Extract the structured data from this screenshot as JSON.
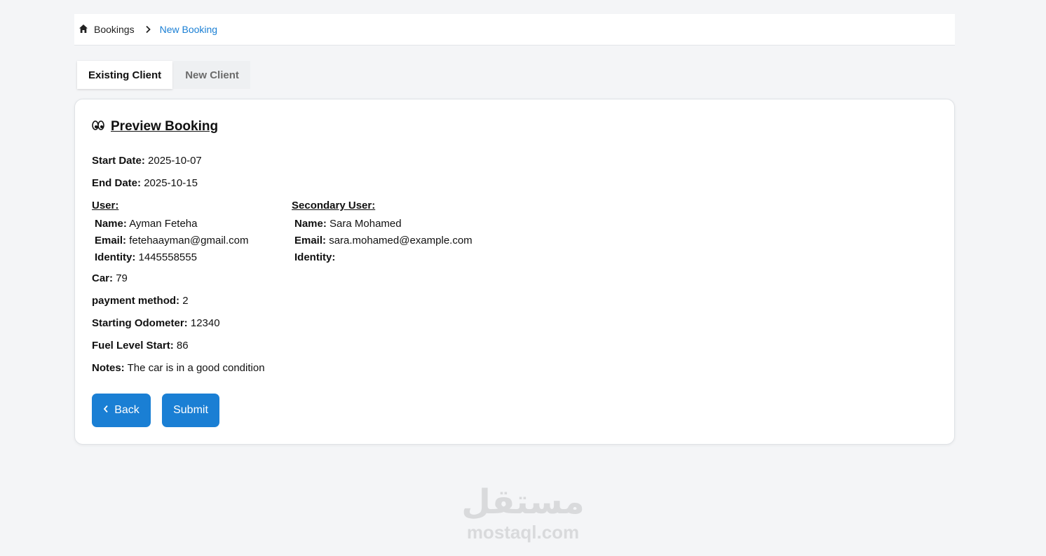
{
  "breadcrumb": {
    "home_icon": "home-icon",
    "home_label": "Bookings",
    "separator_icon": "chevron-right-icon",
    "current_label": "New Booking"
  },
  "tabs": [
    {
      "label": "Existing Client",
      "active": true
    },
    {
      "label": "New Client",
      "active": false
    }
  ],
  "preview": {
    "icon": "eyes-icon",
    "title": "Preview Booking",
    "start_date_label": "Start Date:",
    "start_date": "2025-10-07",
    "end_date_label": "End Date:",
    "end_date": "2025-10-15",
    "user": {
      "heading": "User:",
      "name_label": "Name:",
      "name": "Ayman Feteha",
      "email_label": "Email:",
      "email": "fetehaayman@gmail.com",
      "identity_label": "Identity:",
      "identity": "1445558555"
    },
    "secondary_user": {
      "heading": "Secondary User:",
      "name_label": "Name:",
      "name": "Sara Mohamed",
      "email_label": "Email:",
      "email": "sara.mohamed@example.com",
      "identity_label": "Identity:",
      "identity": ""
    },
    "car_label": "Car:",
    "car": "79",
    "payment_label": "payment method:",
    "payment": "2",
    "odometer_label": "Starting Odometer:",
    "odometer": "12340",
    "fuel_label": "Fuel Level Start:",
    "fuel": "86",
    "notes_label": "Notes:",
    "notes": "The car is in a good condition"
  },
  "actions": {
    "back_icon": "chevron-left-icon",
    "back_label": "Back",
    "submit_label": "Submit"
  },
  "watermark": {
    "logo_text": "مستقل",
    "url": "mostaql.com"
  },
  "colors": {
    "accent": "#1a7fd4",
    "background": "#f4f5f7"
  }
}
